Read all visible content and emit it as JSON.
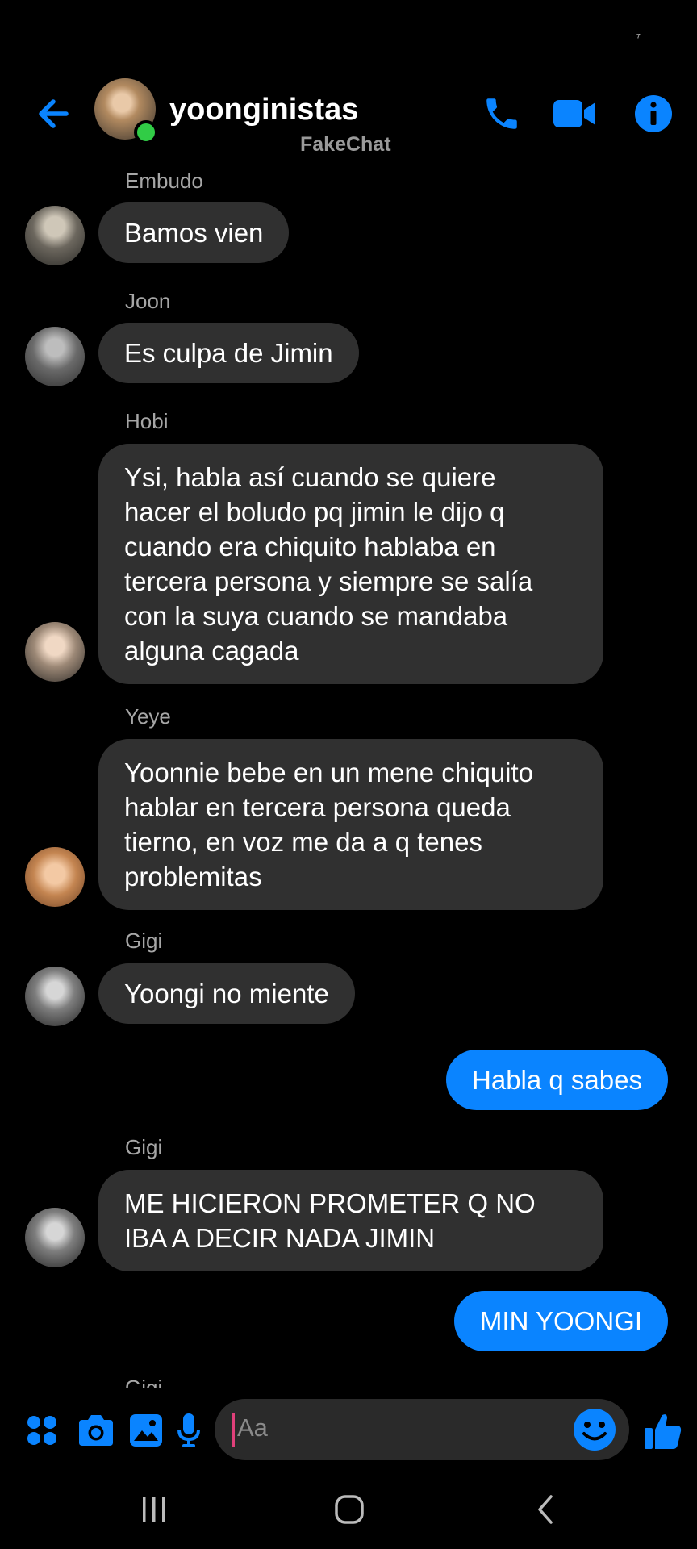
{
  "status": {
    "glyph": "⁷"
  },
  "header": {
    "title": "yoonginistas",
    "subtitle": "FakeChat",
    "icons": {
      "back": "arrow-left",
      "call": "phone",
      "video": "video-camera",
      "info": "info-circle"
    },
    "accent": "#0a84ff",
    "online_color": "#31cc46"
  },
  "messages": [
    {
      "sender": "Embudo",
      "text": "Bamos vien",
      "outgoing": false
    },
    {
      "sender": "Joon",
      "text": "Es culpa de Jimin",
      "outgoing": false
    },
    {
      "sender": "Hobi",
      "lines": [
        "Ysi, habla así cuando se quiere",
        "hacer el boludo pq jimin le dijo q",
        "cuando era chiquito hablaba en",
        "tercera persona y siempre se salía",
        "con la suya cuando se mandaba",
        "alguna cagada"
      ],
      "outgoing": false
    },
    {
      "sender": "Yeye",
      "lines": [
        "Yoonnie bebe en un mene chiquito",
        "hablar en tercera persona queda",
        "tierno, en voz me da a q tenes",
        "problemitas"
      ],
      "outgoing": false
    },
    {
      "sender": "Gigi",
      "text": "Yoongi no miente",
      "outgoing": false
    },
    {
      "text": "Habla q sabes",
      "outgoing": true
    },
    {
      "sender": "Gigi",
      "lines": [
        "ME HICIERON PROMETER Q NO",
        "IBA A DECIR NADA JIMIN"
      ],
      "outgoing": false
    },
    {
      "text": "MIN YOONGI",
      "outgoing": true
    },
    {
      "sender": "Gigi",
      "partial": true
    }
  ],
  "composer": {
    "placeholder": "Aa",
    "icons": [
      "grid-menu",
      "camera",
      "gallery",
      "microphone",
      "emoji",
      "thumbs-up"
    ]
  },
  "navbar": {
    "icons": [
      "recent-apps",
      "home",
      "back"
    ]
  },
  "colors": {
    "incoming_bubble": "#303030",
    "outgoing_bubble": "#0a84ff",
    "background": "#000000"
  }
}
